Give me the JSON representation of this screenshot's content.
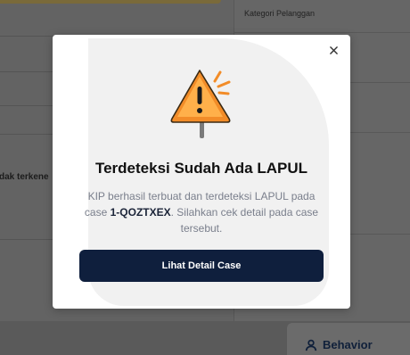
{
  "background": {
    "kategori_label": "Kategori Pelanggan",
    "left_snippet": "dak terkene",
    "behavior_label": "Behavior",
    "behavior_icon": "person-icon"
  },
  "modal": {
    "title": "Terdeteksi Sudah Ada LAPUL",
    "body_prefix": "KIP berhasil terbuat dan terdeteksi LAPUL pada case ",
    "case_id": "1-QOZTXEX",
    "body_suffix": ". Silahkan cek detail pada case tersebut.",
    "button_label": "Lihat Detail Case",
    "close_icon": "close-icon",
    "illustration_icon": "warning-sign-icon"
  },
  "colors": {
    "primary_button": "#0f1f3d",
    "warning": "#f28c28",
    "overlay": "#5e5e5e"
  }
}
